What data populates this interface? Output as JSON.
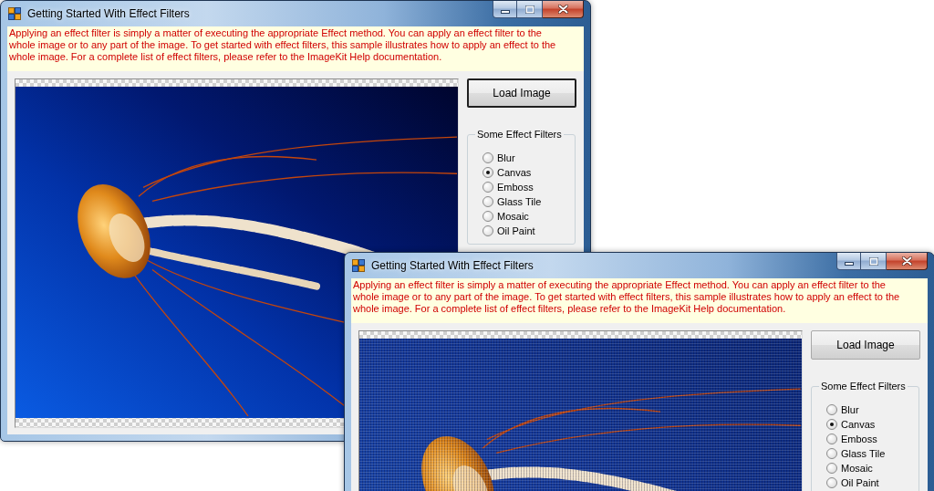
{
  "windows": [
    {
      "title": "Getting Started With Effect Filters",
      "description": "Applying an effect filter is simply a matter of executing the appropriate Effect method. You can apply an effect filter to the whole image or to any part of the image. To get started with effect filters, this sample illustrates how to apply an effect to the whole image. For a complete list of effect filters, please refer to the ImageKit Help documentation.",
      "photo": {
        "kind": "plain"
      },
      "load_button": {
        "label": "Load Image",
        "focused": true
      },
      "filters": {
        "title": "Some Effect Filters",
        "options": [
          {
            "label": "Blur",
            "selected": false
          },
          {
            "label": "Canvas",
            "selected": true
          },
          {
            "label": "Emboss",
            "selected": false
          },
          {
            "label": "Glass Tile",
            "selected": false
          },
          {
            "label": "Mosaic",
            "selected": false
          },
          {
            "label": "Oil Paint",
            "selected": false
          }
        ]
      }
    },
    {
      "title": "Getting Started With Effect Filters",
      "description": "Applying an effect filter is simply a matter of executing the appropriate Effect method. You can apply an effect filter to the whole image or to any part of the image. To get started with effect filters, this sample illustrates how to apply an effect to the whole image. For a complete list of effect filters, please refer to the ImageKit Help documentation.",
      "photo": {
        "kind": "canvas"
      },
      "load_button": {
        "label": "Load Image",
        "focused": false
      },
      "filters": {
        "title": "Some Effect Filters",
        "options": [
          {
            "label": "Blur",
            "selected": false
          },
          {
            "label": "Canvas",
            "selected": true
          },
          {
            "label": "Emboss",
            "selected": false
          },
          {
            "label": "Glass Tile",
            "selected": false
          },
          {
            "label": "Mosaic",
            "selected": false
          },
          {
            "label": "Oil Paint",
            "selected": false
          }
        ]
      }
    }
  ]
}
